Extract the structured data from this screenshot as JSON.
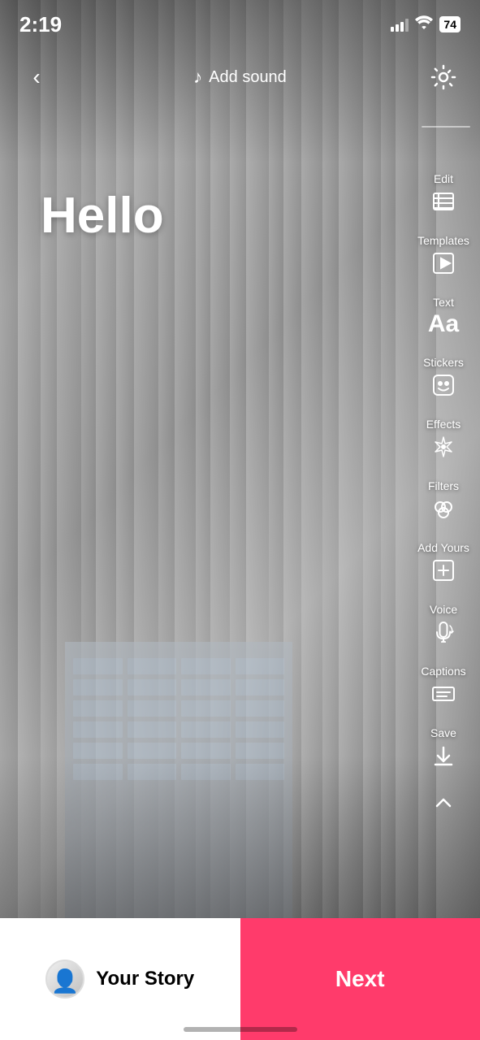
{
  "statusBar": {
    "time": "2:19",
    "battery": "74"
  },
  "topBar": {
    "addSound": "Add sound",
    "backLabel": "back"
  },
  "mainText": "Hello",
  "tools": [
    {
      "id": "edit",
      "label": "Edit",
      "icon": "edit"
    },
    {
      "id": "templates",
      "label": "Templates",
      "icon": "templates"
    },
    {
      "id": "text",
      "label": "Text",
      "icon": "text"
    },
    {
      "id": "stickers",
      "label": "Stickers",
      "icon": "stickers"
    },
    {
      "id": "effects",
      "label": "Effects",
      "icon": "effects"
    },
    {
      "id": "filters",
      "label": "Filters",
      "icon": "filters"
    },
    {
      "id": "add-yours",
      "label": "Add Yours",
      "icon": "add-yours"
    },
    {
      "id": "voice",
      "label": "Voice",
      "icon": "voice"
    },
    {
      "id": "captions",
      "label": "Captions",
      "icon": "captions"
    },
    {
      "id": "save",
      "label": "Save",
      "icon": "save"
    }
  ],
  "bottomBar": {
    "yourStory": "Your Story",
    "next": "Next"
  }
}
